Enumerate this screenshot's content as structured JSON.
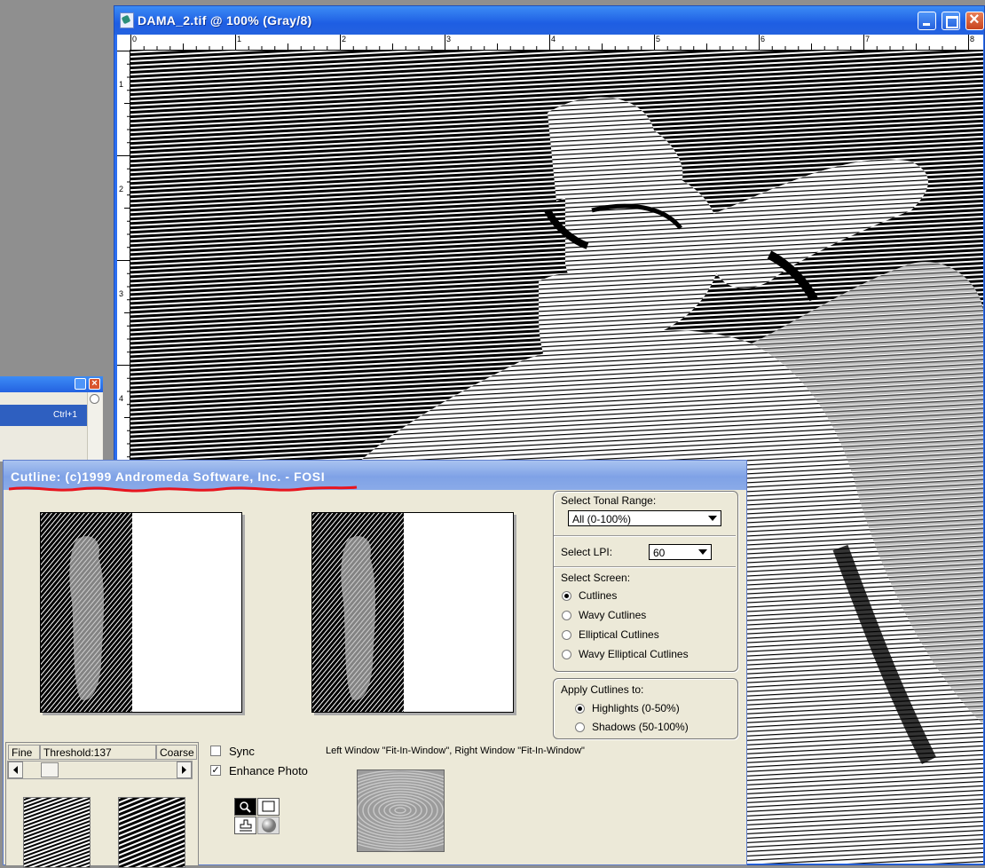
{
  "document": {
    "title": "DAMA_2.tif @ 100% (Gray/8)",
    "ruler_top": [
      "0",
      "1",
      "2",
      "3",
      "4",
      "5",
      "6",
      "7",
      "8"
    ],
    "ruler_left": [
      "1",
      "2",
      "3",
      "4"
    ]
  },
  "left_panel": {
    "shortcut": "Ctrl+1"
  },
  "cutline": {
    "title": "Cutline: (c)1999 Andromeda Software, Inc. - FOSI",
    "tonal_range_label": "Select Tonal Range:",
    "tonal_range_value": "All (0-100%)",
    "lpi_label": "Select LPI:",
    "lpi_value": "60",
    "screen_label": "Select Screen:",
    "screens": [
      {
        "label": "Cutlines",
        "selected": true
      },
      {
        "label": "Wavy Cutlines",
        "selected": false
      },
      {
        "label": "Elliptical Cutlines",
        "selected": false
      },
      {
        "label": "Wavy Elliptical Cutlines",
        "selected": false
      }
    ],
    "apply_label": "Apply Cutlines to:",
    "apply_options": [
      {
        "label": "Highlights (0-50%)",
        "selected": true
      },
      {
        "label": "Shadows (50-100%)",
        "selected": false
      }
    ],
    "fine_label": "Fine",
    "threshold_label": "Threshold:137",
    "coarse_label": "Coarse",
    "sync_label": "Sync",
    "sync_checked": false,
    "enhance_label": "Enhance Photo",
    "enhance_checked": true,
    "window_info": "Left Window \"Fit-In-Window\", Right Window \"Fit-In-Window\""
  },
  "colors": {
    "titlebar": "#2462e0",
    "dialog_bg": "#ece9d8",
    "underline": "#e8141e"
  }
}
